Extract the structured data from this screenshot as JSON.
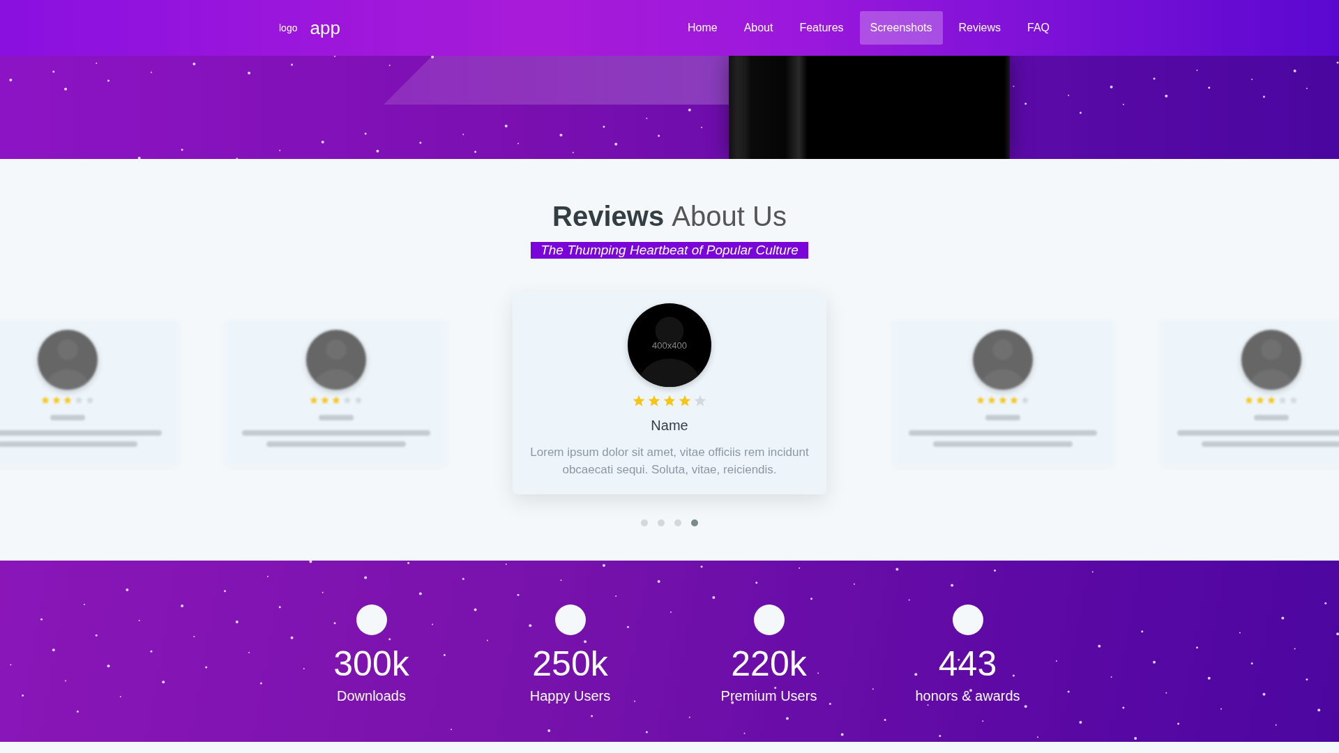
{
  "header": {
    "logo_small": "logo",
    "logo_text": "app",
    "nav": [
      {
        "label": "Home",
        "selected": false
      },
      {
        "label": "About",
        "selected": false
      },
      {
        "label": "Features",
        "selected": false
      },
      {
        "label": "Screenshots",
        "selected": true
      },
      {
        "label": "Reviews",
        "selected": false
      },
      {
        "label": "FAQ",
        "selected": false
      }
    ]
  },
  "reviews": {
    "title_bold": "Reviews",
    "title_light": "About Us",
    "subtitle": "The Thumping Heartbeat of Popular Culture",
    "cards": [
      {
        "kind": "side",
        "stars": 3
      },
      {
        "kind": "side",
        "stars": 3
      },
      {
        "kind": "main",
        "avatar_label": "400x400",
        "stars": 4,
        "name": "Name",
        "text": "Lorem ipsum dolor sit amet, vitae officiis rem incidunt obcaecati sequi. Soluta, vitae, reiciendis."
      },
      {
        "kind": "side",
        "stars": 4
      },
      {
        "kind": "side",
        "stars": 3
      }
    ],
    "dots": [
      {
        "selected": false
      },
      {
        "selected": false
      },
      {
        "selected": false
      },
      {
        "selected": true
      }
    ]
  },
  "stats": [
    {
      "value": "300k",
      "label": "Downloads"
    },
    {
      "value": "250k",
      "label": "Happy Users"
    },
    {
      "value": "220k",
      "label": "Premium Users"
    },
    {
      "value": "443",
      "label": "honors & awards"
    }
  ]
}
